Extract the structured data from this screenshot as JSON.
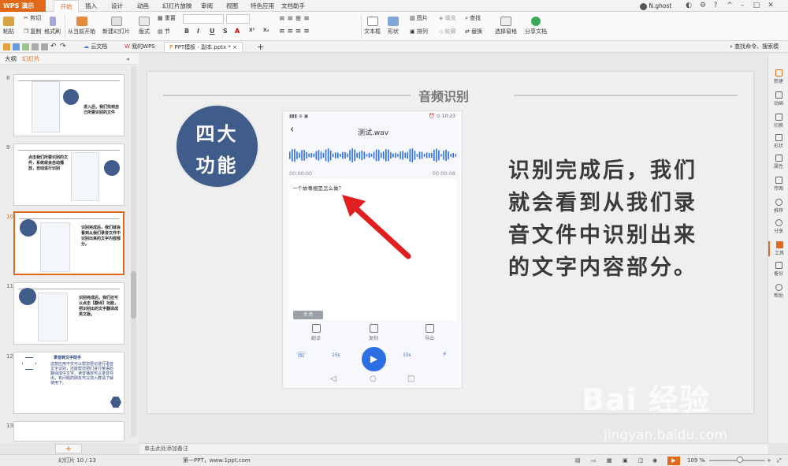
{
  "titlebar": {
    "app_name": "WPS 演示",
    "tabs": [
      "开始",
      "插入",
      "设计",
      "动画",
      "幻灯片放映",
      "审阅",
      "视图",
      "特色应用",
      "文档助手"
    ],
    "active_tab": "开始",
    "user": "N.ghost"
  },
  "ribbon": {
    "paste": "粘贴",
    "cut": "剪切",
    "copy": "复制",
    "format_painter": "格式刷",
    "from_current": "从当前开始",
    "new_slide": "新建幻灯片",
    "layout": "版式",
    "section": "节",
    "reset": "重置",
    "text_box": "文本框",
    "shape": "形状",
    "arrange": "排列",
    "picture": "图片",
    "fill": "填充",
    "outline": "轮廓",
    "find": "查找",
    "replace": "替换",
    "select_pane": "选择窗格",
    "share_doc": "分享文档",
    "format_buttons": [
      "B",
      "I",
      "U",
      "S",
      "A",
      "X²",
      "X₂"
    ],
    "search_commands": "查找命令、搜索模板"
  },
  "tabsbar": {
    "tabs": [
      "云文档",
      "我的WPS",
      "PPT模板 - 副本.pptx *"
    ],
    "active": "PPT模板 - 副本.pptx *"
  },
  "panel": {
    "outline_tab": "大纲",
    "slides_tab": "幻灯片",
    "slide_numbers": [
      "8",
      "9",
      "10",
      "11",
      "12",
      "13"
    ],
    "thumb8_text": "进入后，我们找到自己所要识别的文件",
    "thumb9_text": "点击我们所要识别的文件，系统就会自动播放，自动进行识别",
    "thumb10_text": "识别完成后，我们就会看到从我们录音文件中识别出来的文字内容部分。",
    "thumb11_text": "识别完成后，我们还可以点击【翻译】功能，把识别出的文字翻译成英文版。",
    "thumb12_title": "录音转文字助手",
    "thumb12_text": "这款应用不仅可以帮您把记进行语音文字识别，还能帮您把们进行英语的翻译成中文字，读音播放可以录音导出，有问题的朋友可以加入群请了解使用下。",
    "thumb_circle": "四大功能",
    "add_button": "+"
  },
  "slide": {
    "title": "音频识别",
    "circle_line1": "四大",
    "circle_line2": "功能",
    "body": "识别完成后，我们就会看到从我们录音文件中识别出来的文字内容部分。",
    "phone": {
      "status_left": "▮▮▮ ⊕ ▣",
      "status_right": "⏰ ⊙ 10:23",
      "title": "测试.wav",
      "time_start": "00:00:00",
      "time_end": "00:00:08",
      "recognized": "一个故事报是怎么做？",
      "chip": "全 选",
      "actions": [
        "翻译",
        "复制",
        "导出"
      ],
      "controls": [
        "☏",
        "15s",
        "15s",
        "⚡"
      ],
      "nav": [
        "◁",
        "○",
        "□"
      ]
    }
  },
  "rightbar": {
    "items": [
      "新建",
      "动画",
      "切换",
      "形状",
      "属性",
      "传图",
      "推荐",
      "分享",
      "工具",
      "备份",
      "帮助"
    ]
  },
  "notes": "单击此处添加备注",
  "statusbar": {
    "slide_info": "幻灯片 10 / 13",
    "theme": "第一PPT，www.1ppt.com",
    "zoom": "109 %"
  },
  "watermark": {
    "logo": "Bai  经验",
    "url": "jingyan.baidu.com"
  }
}
